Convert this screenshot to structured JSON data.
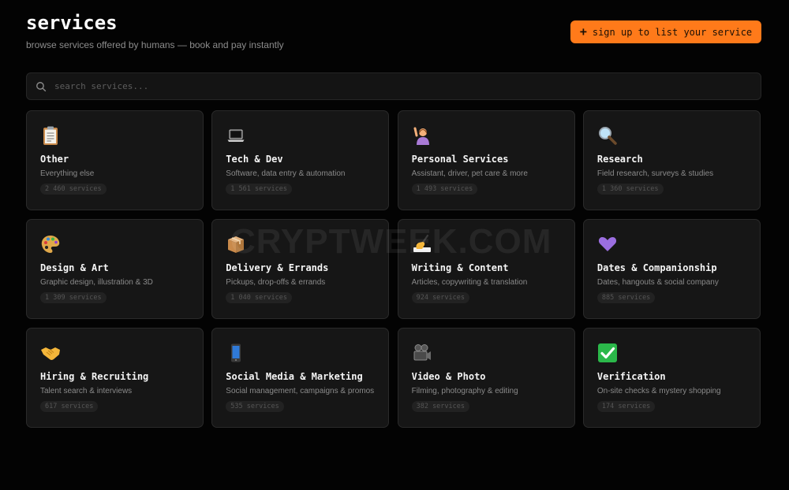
{
  "header": {
    "title": "services",
    "subtitle": "browse services offered by humans — book and pay instantly",
    "signup_label": "sign up to list your service"
  },
  "search": {
    "placeholder": "search services..."
  },
  "categories": [
    {
      "icon": "clipboard-icon",
      "title": "Other",
      "desc": "Everything else",
      "count": "2 460 services"
    },
    {
      "icon": "laptop-icon",
      "title": "Tech & Dev",
      "desc": "Software, data entry & automation",
      "count": "1 561 services"
    },
    {
      "icon": "person-raising-hand-icon",
      "title": "Personal Services",
      "desc": "Assistant, driver, pet care & more",
      "count": "1 493 services"
    },
    {
      "icon": "magnifying-glass-icon",
      "title": "Research",
      "desc": "Field research, surveys & studies",
      "count": "1 360 services"
    },
    {
      "icon": "palette-icon",
      "title": "Design & Art",
      "desc": "Graphic design, illustration & 3D",
      "count": "1 309 services"
    },
    {
      "icon": "package-icon",
      "title": "Delivery & Errands",
      "desc": "Pickups, drop-offs & errands",
      "count": "1 040 services"
    },
    {
      "icon": "writing-hand-icon",
      "title": "Writing & Content",
      "desc": "Articles, copywriting & translation",
      "count": "924 services"
    },
    {
      "icon": "purple-heart-icon",
      "title": "Dates & Companionship",
      "desc": "Dates, hangouts & social company",
      "count": "885 services"
    },
    {
      "icon": "handshake-icon",
      "title": "Hiring & Recruiting",
      "desc": "Talent search & interviews",
      "count": "617 services"
    },
    {
      "icon": "mobile-phone-icon",
      "title": "Social Media & Marketing",
      "desc": "Social management, campaigns & promos",
      "count": "535 services"
    },
    {
      "icon": "movie-camera-icon",
      "title": "Video & Photo",
      "desc": "Filming, photography & editing",
      "count": "382 services"
    },
    {
      "icon": "check-mark-icon",
      "title": "Verification",
      "desc": "On-site checks & mystery shopping",
      "count": "174 services"
    }
  ],
  "watermark": "CRYPTWEEK.COM",
  "colors": {
    "background": "#030303",
    "card": "#161616",
    "accent": "#ff7a1a"
  }
}
